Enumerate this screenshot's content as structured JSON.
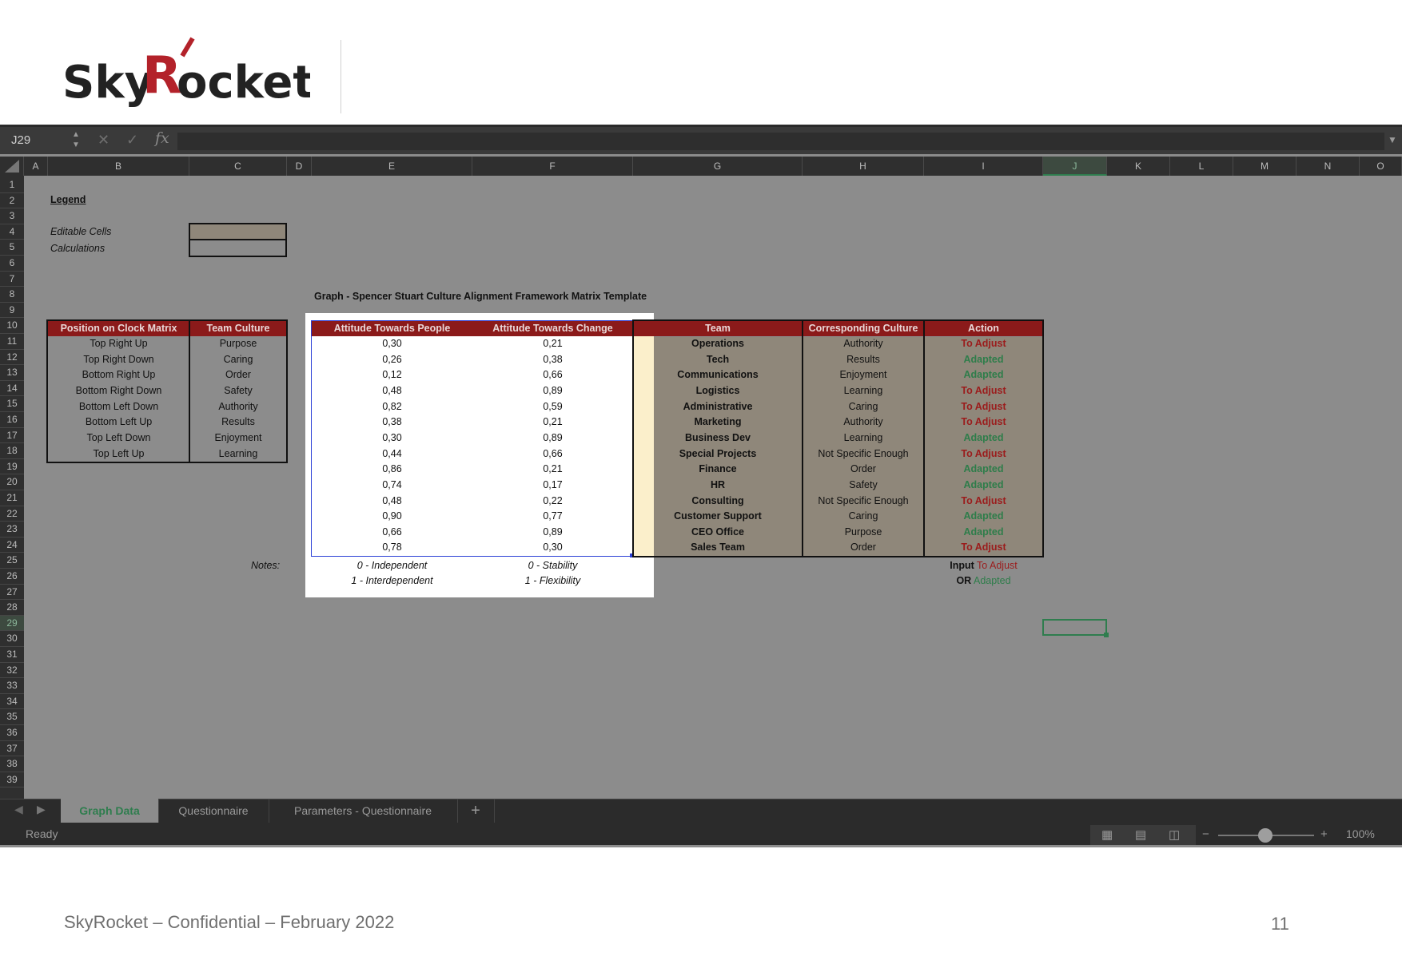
{
  "logo": {
    "text_sky": "Sky",
    "text_r": "R",
    "text_ocket": "ocket"
  },
  "namebox": "J29",
  "columns": [
    "A",
    "B",
    "C",
    "D",
    "E",
    "F",
    "G",
    "H",
    "I",
    "J",
    "K",
    "L",
    "M",
    "N",
    "O"
  ],
  "selected_column": "J",
  "rows": [
    "1",
    "2",
    "3",
    "4",
    "5",
    "6",
    "7",
    "8",
    "9",
    "10",
    "11",
    "12",
    "13",
    "14",
    "15",
    "16",
    "17",
    "18",
    "19",
    "20",
    "21",
    "22",
    "23",
    "24",
    "25",
    "26",
    "27",
    "28",
    "29",
    "30",
    "31",
    "32",
    "33",
    "34",
    "35",
    "36",
    "37",
    "38",
    "39"
  ],
  "selected_row": "29",
  "legend": {
    "title": "Legend",
    "editable": "Editable Cells",
    "calculations": "Calculations"
  },
  "graph_title": "Graph - Spencer Stuart Culture Alignment Framework Matrix Template",
  "clock_table": {
    "headers": [
      "Position on Clock Matrix",
      "Team Culture"
    ],
    "rows": [
      [
        "Top Right Up",
        "Purpose"
      ],
      [
        "Top Right Down",
        "Caring"
      ],
      [
        "Bottom Right Up",
        "Order"
      ],
      [
        "Bottom Right Down",
        "Safety"
      ],
      [
        "Bottom Left Down",
        "Authority"
      ],
      [
        "Bottom Left Up",
        "Results"
      ],
      [
        "Top Left Down",
        "Enjoyment"
      ],
      [
        "Top Left Up",
        "Learning"
      ]
    ]
  },
  "data_table": {
    "headers": [
      "Attitude Towards People",
      "Attitude Towards Change",
      "Team",
      "Corresponding Culture",
      "Action"
    ],
    "rows": [
      [
        "0,30",
        "0,21",
        "Operations",
        "Authority",
        "To Adjust"
      ],
      [
        "0,26",
        "0,38",
        "Tech",
        "Results",
        "Adapted"
      ],
      [
        "0,12",
        "0,66",
        "Communications",
        "Enjoyment",
        "Adapted"
      ],
      [
        "0,48",
        "0,89",
        "Logistics",
        "Learning",
        "To Adjust"
      ],
      [
        "0,82",
        "0,59",
        "Administrative",
        "Caring",
        "To Adjust"
      ],
      [
        "0,38",
        "0,21",
        "Marketing",
        "Authority",
        "To Adjust"
      ],
      [
        "0,30",
        "0,89",
        "Business Dev",
        "Learning",
        "Adapted"
      ],
      [
        "0,44",
        "0,66",
        "Special Projects",
        "Not Specific Enough",
        "To Adjust"
      ],
      [
        "0,86",
        "0,21",
        "Finance",
        "Order",
        "Adapted"
      ],
      [
        "0,74",
        "0,17",
        "HR",
        "Safety",
        "Adapted"
      ],
      [
        "0,48",
        "0,22",
        "Consulting",
        "Not Specific Enough",
        "To Adjust"
      ],
      [
        "0,90",
        "0,77",
        "Customer Support",
        "Caring",
        "Adapted"
      ],
      [
        "0,66",
        "0,89",
        "CEO Office",
        "Purpose",
        "Adapted"
      ],
      [
        "0,78",
        "0,30",
        "Sales Team",
        "Order",
        "To Adjust"
      ]
    ]
  },
  "notes": {
    "label": "Notes:",
    "people_0": "0 - Independent",
    "people_1": "1 - Interdependent",
    "change_0": "0 - Stability",
    "change_1": "1 - Flexibility",
    "input_prefix": "Input",
    "input_value": "To Adjust",
    "or_prefix": "OR",
    "or_value": "Adapted"
  },
  "tabs": [
    "Graph Data",
    "Questionnaire",
    "Parameters - Questionnaire",
    "+"
  ],
  "status": "Ready",
  "zoom": "100%",
  "footer": {
    "left": "SkyRocket – Confidential – February 2022",
    "page": "11"
  },
  "colors": {
    "header_red": "#8b1a1a",
    "adjust_red": "#9b1c1c",
    "adapted_green": "#2e7d4a",
    "editable": "#8f877a"
  }
}
